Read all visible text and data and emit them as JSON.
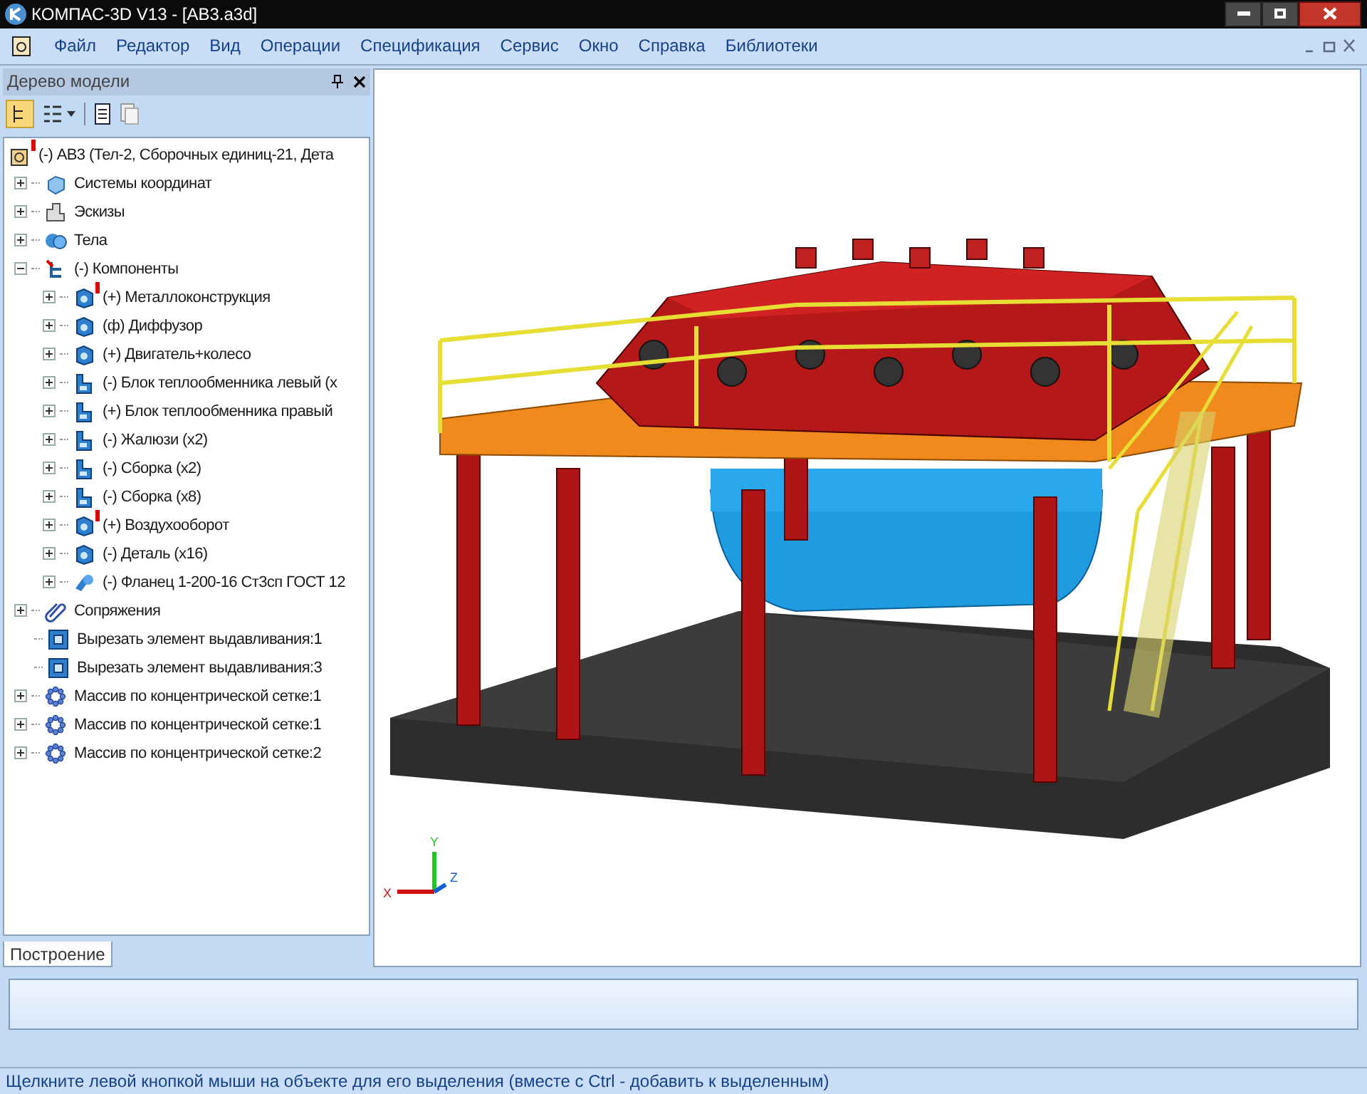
{
  "window": {
    "title": "КОМПАС-3D V13 - [АВ3.a3d]"
  },
  "menu": [
    "Файл",
    "Редактор",
    "Вид",
    "Операции",
    "Спецификация",
    "Сервис",
    "Окно",
    "Справка",
    "Библиотеки"
  ],
  "tree_panel": {
    "title": "Дерево модели",
    "tab": {
      "label": "Построение",
      "selected": true
    }
  },
  "tree": [
    {
      "label": "(-) АВ3 (Тел-2, Сборочных единиц-21, Дета",
      "kind": "root",
      "warning": true,
      "children": [
        {
          "label": "Системы координат",
          "kind": "coordinates",
          "expanded": false,
          "warning": false
        },
        {
          "label": "Эскизы",
          "kind": "sketches",
          "expanded": false,
          "warning": false
        },
        {
          "label": "Тела",
          "kind": "bodies",
          "expanded": false,
          "warning": false
        },
        {
          "label": "(-) Компоненты",
          "kind": "components",
          "expanded": true,
          "warning": false,
          "children": [
            {
              "label": "(+) Металлоконструкция",
              "kind": "part",
              "expanded": false,
              "warning": true
            },
            {
              "label": "(ф) Диффузор",
              "kind": "part",
              "expanded": false,
              "warning": false
            },
            {
              "label": "(+) Двигатель+колесо",
              "kind": "part",
              "expanded": false,
              "warning": false
            },
            {
              "label": "(-) Блок теплообменника левый (x",
              "kind": "assembly",
              "expanded": false,
              "warning": false
            },
            {
              "label": "(+) Блок теплообменника правый",
              "kind": "assembly",
              "expanded": false,
              "warning": false
            },
            {
              "label": "(-) Жалюзи (x2)",
              "kind": "assembly",
              "expanded": false,
              "warning": false
            },
            {
              "label": "(-) Сборка (x2)",
              "kind": "assembly",
              "expanded": false,
              "warning": false
            },
            {
              "label": "(-) Сборка (x8)",
              "kind": "assembly",
              "expanded": false,
              "warning": false
            },
            {
              "label": "(+) Воздухооборот",
              "kind": "part",
              "expanded": false,
              "warning": true
            },
            {
              "label": "(-) Деталь (x16)",
              "kind": "part",
              "expanded": false,
              "warning": false
            },
            {
              "label": "(-) Фланец 1-200-16 Ст3сп ГОСТ 12",
              "kind": "flange",
              "expanded": false,
              "warning": false
            }
          ]
        },
        {
          "label": "Сопряжения",
          "kind": "mates",
          "expanded": false,
          "warning": false
        },
        {
          "label": "Вырезать элемент выдавливания:1",
          "kind": "cut",
          "warning": false
        },
        {
          "label": "Вырезать элемент выдавливания:3",
          "kind": "cut",
          "warning": false
        },
        {
          "label": "Массив по концентрической сетке:1",
          "kind": "pattern",
          "expanded": false,
          "warning": false
        },
        {
          "label": "Массив по концентрической сетке:1",
          "kind": "pattern",
          "expanded": false,
          "warning": false
        },
        {
          "label": "Массив по концентрической сетке:2",
          "kind": "pattern",
          "expanded": false,
          "warning": false
        }
      ]
    }
  ],
  "axes": {
    "x": "X",
    "y": "Y",
    "z": "Z"
  },
  "status_bar": {
    "text": "Щелкните левой кнопкой мыши на объекте для его выделения (вместе с Ctrl - добавить к выделенным)"
  }
}
